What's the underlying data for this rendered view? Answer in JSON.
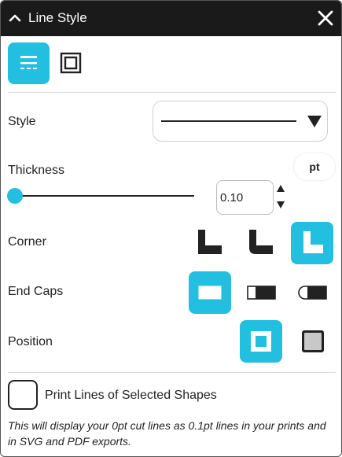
{
  "window": {
    "title": "Line Style",
    "collapse_icon": "chevron-up-icon",
    "close_icon": "close-icon"
  },
  "tabs": [
    {
      "name": "stroke-settings",
      "icon": "line-stroke-icon",
      "active": true
    },
    {
      "name": "border-settings",
      "icon": "square-border-icon",
      "active": false
    }
  ],
  "style": {
    "label": "Style",
    "selected": "solid-line",
    "dropdown_icon": "triangle-down-icon"
  },
  "thickness": {
    "label": "Thickness",
    "value": "0.10",
    "unit": "pt",
    "slider_level": 0,
    "stepper_up_icon": "triangle-up-icon",
    "stepper_down_icon": "triangle-down-icon"
  },
  "corner": {
    "label": "Corner",
    "options": [
      "miter-corner-icon",
      "round-corner-icon",
      "bevel-corner-icon"
    ],
    "selected_index": 2
  },
  "end_caps": {
    "label": "End Caps",
    "options": [
      "square-cap-icon",
      "butt-cap-icon",
      "round-cap-icon"
    ],
    "selected_index": 0
  },
  "position": {
    "label": "Position",
    "options": [
      "inside-position-icon",
      "outside-position-icon"
    ],
    "selected_index": 0
  },
  "print_lines": {
    "label": "Print Lines of Selected Shapes",
    "checked": false,
    "note": "This will display your 0pt cut lines as 0.1pt lines in your prints and in SVG and PDF exports."
  },
  "colors": {
    "accent": "#22bfe0",
    "titlebar": "#1a1a1a",
    "icon_dark": "#222222"
  }
}
